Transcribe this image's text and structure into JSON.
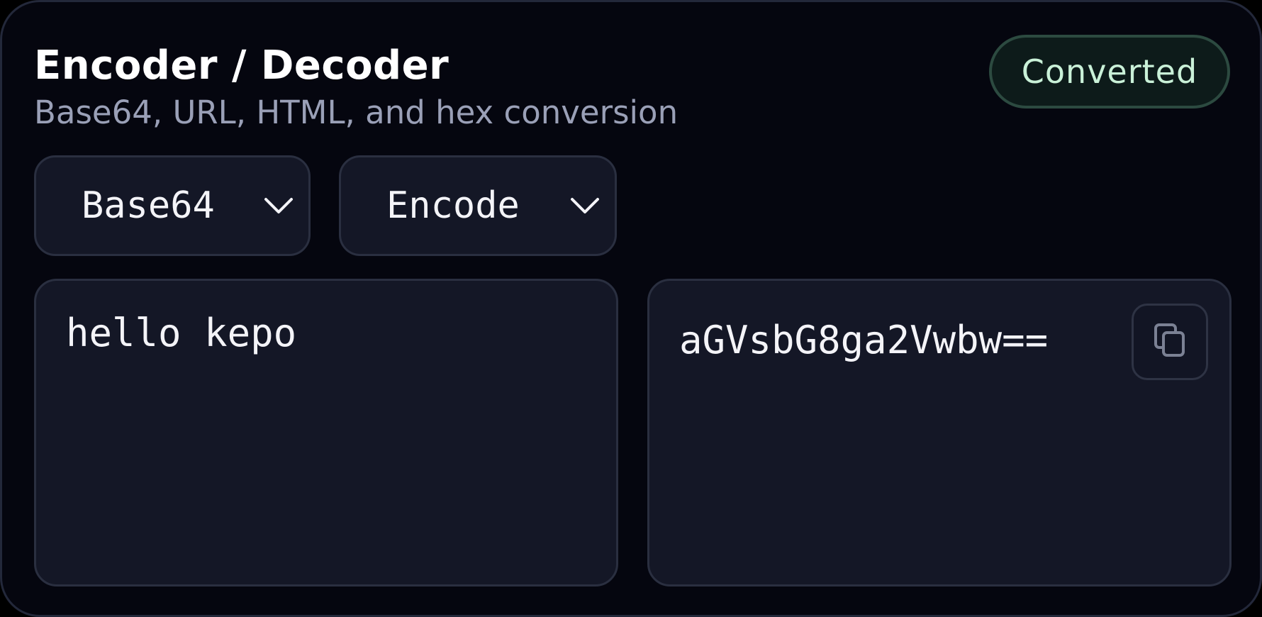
{
  "header": {
    "title": "Encoder / Decoder",
    "subtitle": "Base64, URL, HTML, and hex conversion",
    "status_badge": "Converted"
  },
  "controls": {
    "encoding_type": {
      "selected": "Base64",
      "icon": "chevron-down-icon"
    },
    "mode": {
      "selected": "Encode",
      "icon": "chevron-down-icon"
    }
  },
  "input": {
    "value": "hello kepo"
  },
  "output": {
    "value": "aGVsbG8ga2Vwbw==",
    "copy_icon": "copy-icon"
  },
  "colors": {
    "background": "#05060f",
    "panel": "#141726",
    "border": "#2a2f40",
    "text": "#f4f4f8",
    "muted_text": "#9aa0b7",
    "badge_text": "#c9f1d8",
    "badge_border": "#2c4a40"
  }
}
